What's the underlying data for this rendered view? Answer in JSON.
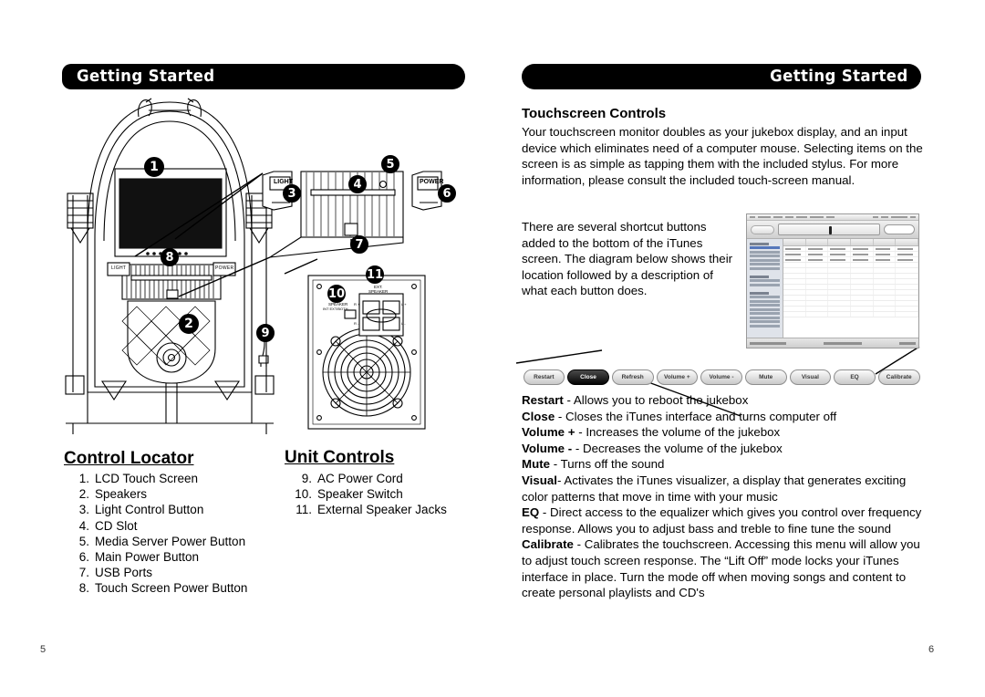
{
  "document": {
    "banner_left": "Getting Started",
    "banner_right": "Getting Started",
    "page_left": "5",
    "page_right": "6"
  },
  "left_page": {
    "control_locator": {
      "heading": "Control Locator",
      "items": [
        {
          "num": "1.",
          "label": "LCD Touch Screen"
        },
        {
          "num": "2.",
          "label": "Speakers"
        },
        {
          "num": "3.",
          "label": "Light Control Button"
        },
        {
          "num": "4.",
          "label": "CD Slot"
        },
        {
          "num": "5.",
          "label": "Media Server Power Button"
        },
        {
          "num": "6.",
          "label": "Main Power Button"
        },
        {
          "num": "7.",
          "label": "USB Ports"
        },
        {
          "num": "8.",
          "label": "Touch Screen Power Button"
        }
      ]
    },
    "unit_controls": {
      "heading": "Unit Controls",
      "items": [
        {
          "num": "9.",
          "label": "AC Power Cord"
        },
        {
          "num": "10.",
          "label": "Speaker Switch"
        },
        {
          "num": "11.",
          "label": "External Speaker Jacks"
        }
      ]
    },
    "diagram": {
      "callouts": [
        "1",
        "2",
        "3",
        "4",
        "5",
        "6",
        "7",
        "8",
        "9",
        "10",
        "11"
      ],
      "panel_labels": {
        "light": "LIGHT",
        "power": "POWER",
        "speaker_switch": "SPEAKER",
        "speaker_switch_sub": "INT EXT/BOTH",
        "ext_speaker": "EXT.",
        "ext_speaker_sub": "SPEAKER",
        "terminal_r_plus": "R +",
        "terminal_l_plus": "L +",
        "terminal_r_minus": "R -",
        "terminal_l_minus": "L -"
      }
    }
  },
  "right_page": {
    "heading": "Touchscreen Controls",
    "intro": "Your touchscreen monitor doubles as your jukebox display, and an input device which eliminates need of a computer mouse.  Selecting items on the screen is as simple as tapping them with the included stylus.  For more information, please consult the included touch-screen manual.",
    "second": "There are several shortcut buttons added to the bottom of the iTunes screen.  The diagram below shows their location followed by a description of what each button does.",
    "buttons": [
      {
        "label": "Restart",
        "active": false
      },
      {
        "label": "Close",
        "active": true
      },
      {
        "label": "Refresh",
        "active": false
      },
      {
        "label": "Volume +",
        "active": false
      },
      {
        "label": "Volume -",
        "active": false
      },
      {
        "label": "Mute",
        "active": false
      },
      {
        "label": "Visual",
        "active": false
      },
      {
        "label": "EQ",
        "active": false
      },
      {
        "label": "Calibrate",
        "active": false
      }
    ],
    "definitions": [
      {
        "term": "Restart",
        "text": " - Allows you to reboot the jukebox"
      },
      {
        "term": "Close",
        "text": "  - Closes the iTunes interface and turns computer off"
      },
      {
        "term": "Volume +",
        "text": " - Increases the volume of the jukebox"
      },
      {
        "term": "Volume -",
        "text": " - Decreases the volume of the jukebox"
      },
      {
        "term": "Mute",
        "text": " - Turns off the sound"
      },
      {
        "term": "Visual",
        "text": "- Activates the iTunes visualizer, a display that generates exciting color patterns that move in time with your music"
      },
      {
        "term": "EQ",
        "text": " - Direct access to the equalizer which gives you control over frequency response.  Allows you to adjust bass and treble to fine tune the sound"
      },
      {
        "term": "Calibrate",
        "text": " - Calibrates the touchscreen.  Accessing this menu will allow you to adjust touch screen response.  The “Lift Off” mode locks your iTunes interface in place.  Turn the mode off when moving songs and content to create personal playlists and CD's"
      }
    ]
  }
}
